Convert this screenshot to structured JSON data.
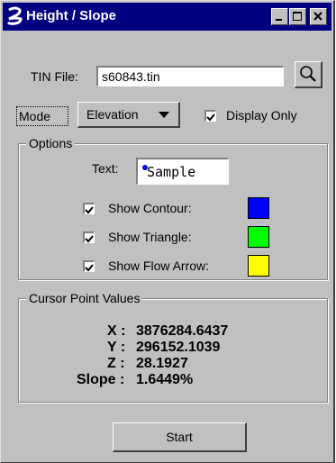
{
  "window": {
    "title": "Height / Slope"
  },
  "tin": {
    "label": "TIN File:",
    "value": "s60843.tin"
  },
  "mode": {
    "label": "Mode",
    "selected": "Elevation",
    "display_only_label": "Display Only",
    "display_only_checked": true
  },
  "options": {
    "title": "Options",
    "text_label": "Text:",
    "sample": "Sample",
    "items": [
      {
        "label": "Show Contour:",
        "checked": true,
        "color": "#0000ff"
      },
      {
        "label": "Show Triangle:",
        "checked": true,
        "color": "#00ff00"
      },
      {
        "label": "Show Flow Arrow:",
        "checked": true,
        "color": "#ffff00"
      }
    ]
  },
  "cursor": {
    "title": "Cursor Point Values",
    "x_label": "X :",
    "x": "3876284.6437",
    "y_label": "Y :",
    "y": "296152.1039",
    "z_label": "Z :",
    "z": "28.1927",
    "slope_label": "Slope :",
    "slope": "1.6449%"
  },
  "start_label": "Start"
}
